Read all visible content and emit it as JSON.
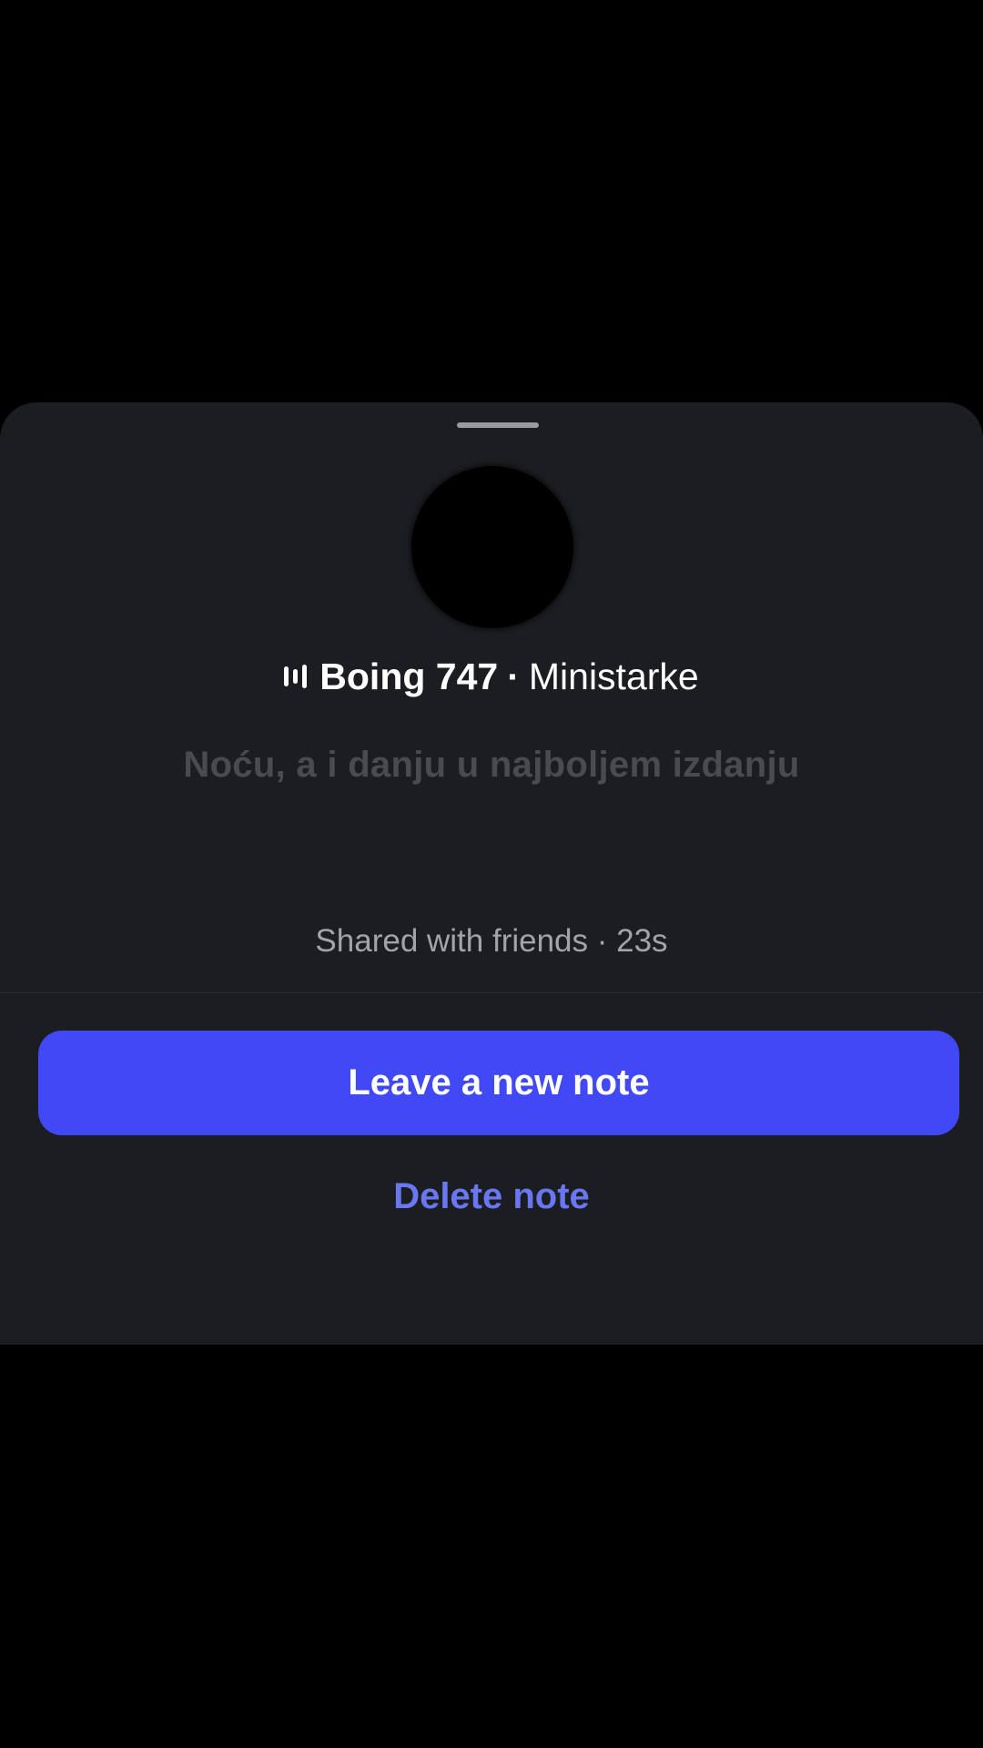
{
  "note_sheet": {
    "music": {
      "icon": "music-bars-icon",
      "song_title": "Boing 747",
      "separator": "·",
      "artist": "Ministarke"
    },
    "lyric": "Noću, a i danju u najboljem izdanju",
    "shared_status": "Shared with friends · 23s",
    "primary_button_label": "Leave a new note",
    "delete_button_label": "Delete note"
  },
  "colors": {
    "background": "#000000",
    "sheet": "#1c1d21",
    "primary_button": "#4049f5",
    "link": "#6a77f2",
    "muted_text": "#a3a4a8",
    "lyric_text": "#4a4b50"
  }
}
